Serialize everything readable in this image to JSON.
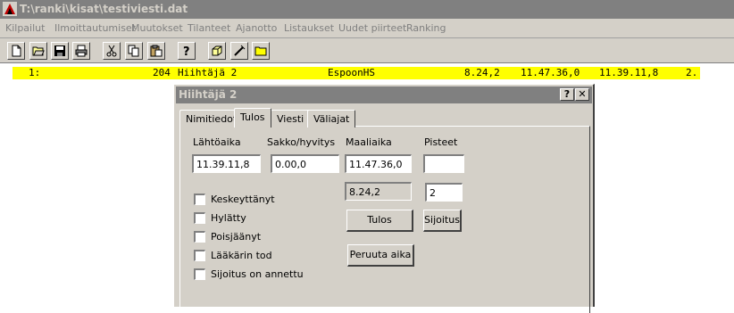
{
  "window": {
    "title": "T:\\ranki\\kisat\\testiviesti.dat",
    "icon": "app-logo-icon"
  },
  "menu": [
    "Kilpailut",
    "Ilmoittautumiset",
    "Muutokset",
    "Tilanteet",
    "Ajanotto",
    "Listaukset",
    "Uudet piirteet",
    "Ranking"
  ],
  "toolbar": [
    "new-file-icon",
    "open-folder-icon",
    "save-icon",
    "print-icon",
    "cut-icon",
    "copy-icon",
    "paste-icon",
    "help-icon",
    "box-icon",
    "pen-icon",
    "folder-icon"
  ],
  "result_row": {
    "position": "1:",
    "number": "204",
    "name": "Hiihtäjä 2",
    "club": "EspoonHS",
    "result_time": "8.24,2",
    "finish_time": "11.47.36,0",
    "start_time": "11.39.11,8",
    "place": "2."
  },
  "dialog": {
    "title": "Hiihtäjä 2",
    "help_label": "?",
    "close_label": "✕",
    "tabs": [
      "Nimitiedot",
      "Tulos",
      "Viesti",
      "Väliajat"
    ],
    "active_tab": "Tulos",
    "labels": {
      "start_time": "Lähtöaika",
      "penalty": "Sakko/hyvitys",
      "finish_time": "Maaliaika",
      "points": "Pisteet"
    },
    "fields": {
      "start_time": "11.39.11,8",
      "penalty": "0.00,0",
      "finish_time": "11.47.36,0",
      "points": "",
      "result": "8.24,2",
      "placement": "2"
    },
    "checkboxes": [
      {
        "label": "Keskeyttänyt",
        "checked": false
      },
      {
        "label": "Hylätty",
        "checked": false
      },
      {
        "label": "Poisjäänyt",
        "checked": false
      },
      {
        "label": "Lääkärin tod",
        "checked": false
      },
      {
        "label": "Sijoitus on annettu",
        "checked": false
      }
    ],
    "buttons": {
      "tulos": "Tulos",
      "sijoitus": "Sijoitus",
      "peruuta": "Peruuta aika"
    }
  }
}
